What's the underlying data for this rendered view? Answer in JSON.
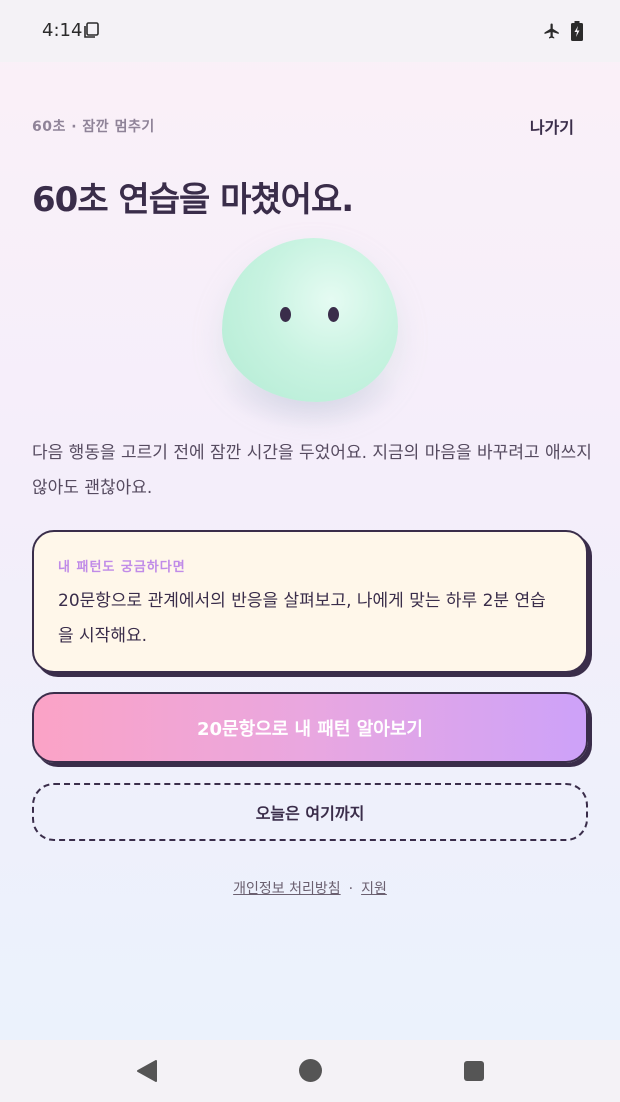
{
  "status_bar": {
    "time": "4:14",
    "icons": [
      "screen-icon",
      "airplane-icon",
      "battery-icon"
    ]
  },
  "header": {
    "top_label": "60초 · 잠깐 멈추기",
    "exit_label": "나가기"
  },
  "main": {
    "title": "60초 연습을 마쳤어요.",
    "description": "다음 행동을 고르기 전에 잠깐 시간을 두었어요. 지금의 마음을 바꾸려고 애쓰지 않아도 괜찮아요."
  },
  "info_card": {
    "label": "내 패턴도 궁금하다면",
    "text": "20문항으로 관계에서의 반응을 살펴보고, 나에게 맞는 하루 2분 연습을 시작해요."
  },
  "buttons": {
    "primary_label": "20문항으로 내 패턴 알아보기",
    "secondary_label": "오늘은 여기까지"
  },
  "footer": {
    "privacy_label": "개인정보 처리방침",
    "separator": "·",
    "support_label": "지원"
  },
  "colors": {
    "ink": "#3a2d4a",
    "card_bg": "#fff7ea",
    "accent_label": "#c08be8",
    "button_gradient_start": "#fba3c6",
    "button_gradient_end": "#cda2f9",
    "blob": "#c8f3e1"
  },
  "nav_bar": {
    "icons": [
      "back-icon",
      "home-icon",
      "recents-icon"
    ]
  }
}
